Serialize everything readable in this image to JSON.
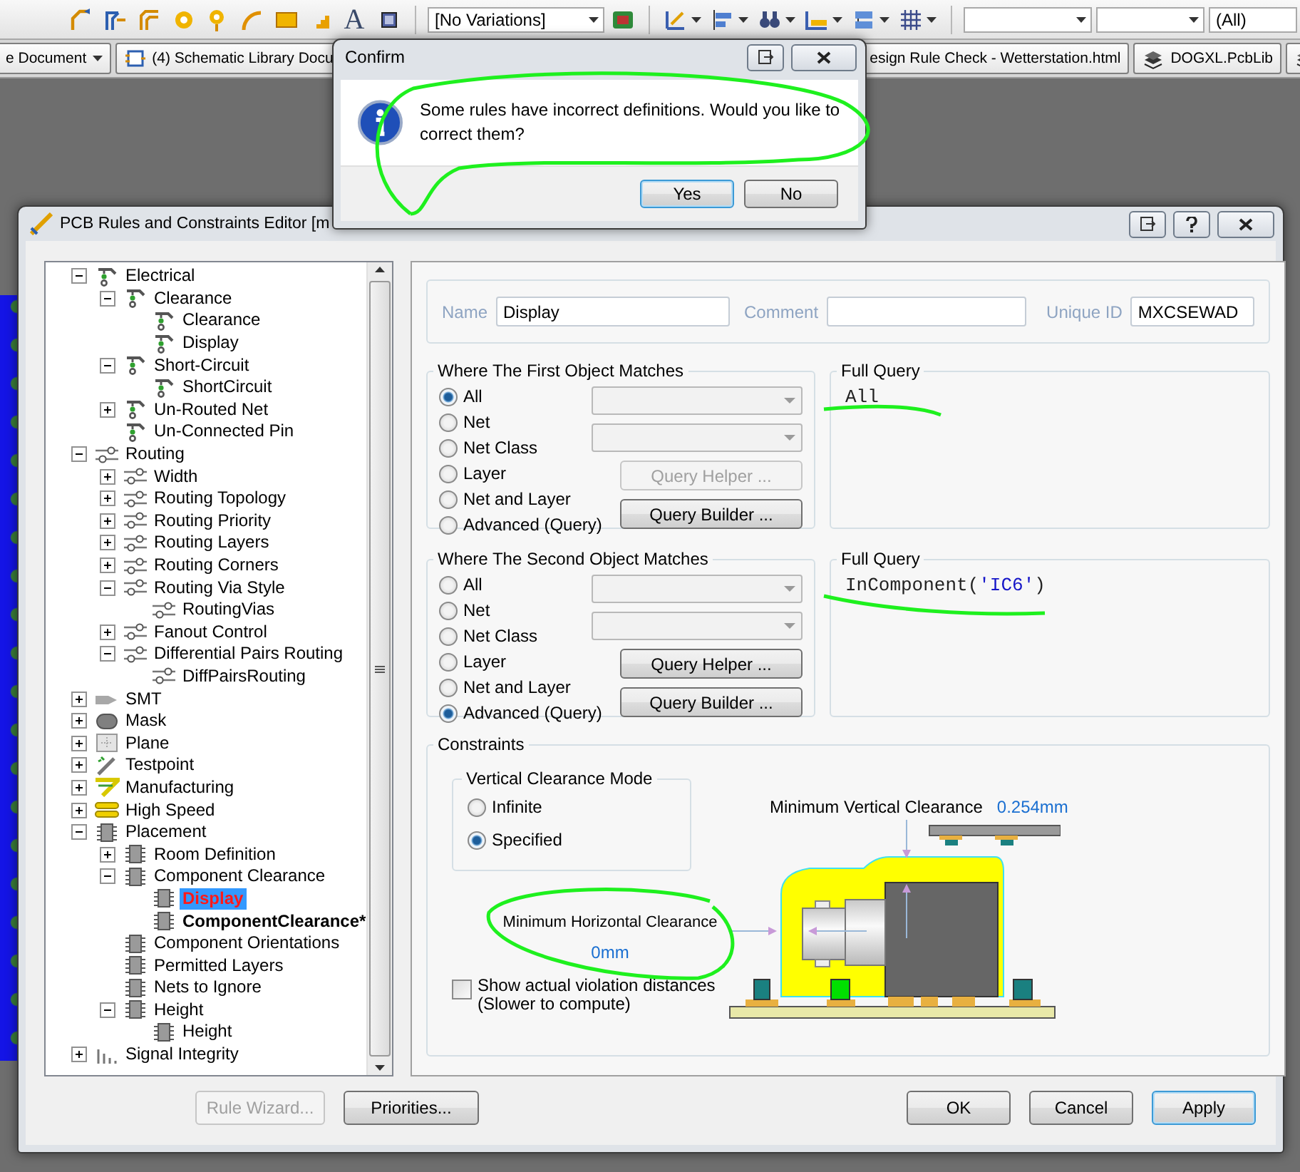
{
  "toolbar": {
    "tools": [
      {
        "kind": "route"
      },
      {
        "kind": "route-multi"
      },
      {
        "kind": "route-diff"
      },
      {
        "kind": "pad"
      },
      {
        "kind": "via"
      },
      {
        "kind": "arc"
      },
      {
        "kind": "fill"
      },
      {
        "kind": "polygon"
      },
      {
        "kind": "text",
        "glyph": "A"
      },
      {
        "kind": "component"
      }
    ],
    "variations": "[No Variations]",
    "menus": [
      {
        "kind": "board",
        "menu": false
      },
      {
        "kind": "place",
        "menu": true
      },
      {
        "kind": "align",
        "menu": true
      },
      {
        "kind": "find",
        "menu": true
      },
      {
        "kind": "ruler",
        "menu": true
      },
      {
        "kind": "layers",
        "menu": true
      },
      {
        "kind": "grid",
        "menu": true
      }
    ],
    "filter": "(All)"
  },
  "documents": [
    {
      "label": "e Document",
      "kind": "plain",
      "menu": true
    },
    {
      "label": "(4) Schematic Library Docu",
      "kind": "schlib",
      "menu": false
    },
    {
      "label": "esign Rule Check - Wetterstation.html",
      "kind": "plain",
      "menu": false
    },
    {
      "label": "DOGXL.PcbLib",
      "kind": "pcblib",
      "menu": false
    },
    {
      "kind": "pcblib",
      "menu": false
    }
  ],
  "editor": {
    "title": "PCB Rules and Constraints Editor [m",
    "tree": [
      {
        "label": "Electrical",
        "kind": "electrical",
        "expanded": true,
        "selected": false,
        "children": [
          {
            "label": "Clearance",
            "kind": "electrical",
            "expanded": true,
            "selected": false,
            "children": [
              {
                "label": "Clearance",
                "kind": "electrical",
                "selected": false
              },
              {
                "label": "Display",
                "kind": "electrical",
                "selected": false
              }
            ]
          },
          {
            "label": "Short-Circuit",
            "kind": "electrical",
            "expanded": true,
            "selected": false,
            "children": [
              {
                "label": "ShortCircuit",
                "kind": "electrical",
                "selected": false
              }
            ]
          },
          {
            "label": "Un-Routed Net",
            "kind": "electrical",
            "expanded": false,
            "selected": false
          },
          {
            "label": "Un-Connected Pin",
            "kind": "electrical",
            "selected": false
          }
        ]
      },
      {
        "label": "Routing",
        "kind": "routing",
        "expanded": true,
        "selected": false,
        "children": [
          {
            "label": "Width",
            "kind": "routing",
            "expanded": false,
            "selected": false
          },
          {
            "label": "Routing Topology",
            "kind": "routing",
            "expanded": false,
            "selected": false
          },
          {
            "label": "Routing Priority",
            "kind": "routing",
            "expanded": false,
            "selected": false
          },
          {
            "label": "Routing Layers",
            "kind": "routing",
            "expanded": false,
            "selected": false
          },
          {
            "label": "Routing Corners",
            "kind": "routing",
            "expanded": false,
            "selected": false
          },
          {
            "label": "Routing Via Style",
            "kind": "routing",
            "expanded": true,
            "selected": false,
            "children": [
              {
                "label": "RoutingVias",
                "kind": "routing",
                "selected": false
              }
            ]
          },
          {
            "label": "Fanout Control",
            "kind": "routing",
            "expanded": false,
            "selected": false
          },
          {
            "label": "Differential Pairs Routing",
            "kind": "routing",
            "expanded": true,
            "selected": false,
            "children": [
              {
                "label": "DiffPairsRouting",
                "kind": "routing",
                "selected": false
              }
            ]
          }
        ]
      },
      {
        "label": "SMT",
        "kind": "smt",
        "expanded": false,
        "selected": false
      },
      {
        "label": "Mask",
        "kind": "mask",
        "expanded": false,
        "selected": false
      },
      {
        "label": "Plane",
        "kind": "plane",
        "expanded": false,
        "selected": false
      },
      {
        "label": "Testpoint",
        "kind": "testpoint",
        "expanded": false,
        "selected": false
      },
      {
        "label": "Manufacturing",
        "kind": "manufacturing",
        "expanded": false,
        "selected": false
      },
      {
        "label": "High Speed",
        "kind": "highspeed",
        "expanded": false,
        "selected": false
      },
      {
        "label": "Placement",
        "kind": "placement",
        "expanded": true,
        "selected": false,
        "children": [
          {
            "label": "Room Definition",
            "kind": "placement",
            "expanded": false,
            "selected": false
          },
          {
            "label": "Component Clearance",
            "kind": "placement",
            "expanded": true,
            "selected": false,
            "children": [
              {
                "label": "Display",
                "kind": "placement",
                "selected": true,
                "has_errors": true
              },
              {
                "label": "ComponentClearance*",
                "kind": "placement",
                "selected": false,
                "unsaved": true
              }
            ]
          },
          {
            "label": "Component Orientations",
            "kind": "placement",
            "selected": false
          },
          {
            "label": "Permitted Layers",
            "kind": "placement",
            "selected": false
          },
          {
            "label": "Nets to Ignore",
            "kind": "placement",
            "selected": false
          },
          {
            "label": "Height",
            "kind": "placement",
            "expanded": true,
            "selected": false,
            "children": [
              {
                "label": "Height",
                "kind": "placement",
                "selected": false
              }
            ]
          }
        ]
      },
      {
        "label": "Signal Integrity",
        "kind": "signal",
        "expanded": false,
        "selected": false
      }
    ],
    "rule": {
      "name_label": "Name",
      "name": "Display",
      "comment_label": "Comment",
      "unique_id_label": "Unique ID",
      "unique_id": "MXCSEWAD"
    },
    "first_object": {
      "title": "Where The First Object Matches",
      "options": [
        {
          "label": "All",
          "selected": true
        },
        {
          "label": "Net",
          "selected": false
        },
        {
          "label": "Net Class",
          "selected": false
        },
        {
          "label": "Layer",
          "selected": false
        },
        {
          "label": "Net and Layer",
          "selected": false
        },
        {
          "label": "Advanced (Query)",
          "selected": false
        }
      ],
      "dropdowns": [
        {
          "disabled": true
        },
        {
          "disabled": true
        }
      ],
      "buttons": [
        {
          "label": "Query Helper ...",
          "disabled": true
        },
        {
          "label": "Query Builder ...",
          "disabled": false
        }
      ]
    },
    "first_query": {
      "title": "Full Query",
      "tokens": [
        {
          "text": "All",
          "kind": "code"
        }
      ]
    },
    "second_object": {
      "title": "Where The Second Object Matches",
      "options": [
        {
          "label": "All",
          "selected": false
        },
        {
          "label": "Net",
          "selected": false
        },
        {
          "label": "Net Class",
          "selected": false
        },
        {
          "label": "Layer",
          "selected": false
        },
        {
          "label": "Net and Layer",
          "selected": false
        },
        {
          "label": "Advanced (Query)",
          "selected": true
        }
      ],
      "dropdowns": [
        {
          "disabled": true
        },
        {
          "disabled": true
        }
      ],
      "buttons": [
        {
          "label": "Query Helper ...",
          "disabled": false
        },
        {
          "label": "Query Builder ...",
          "disabled": false
        }
      ]
    },
    "second_query": {
      "title": "Full Query",
      "tokens": [
        {
          "text": "InComponent(",
          "kind": "code"
        },
        {
          "text": "'IC6'",
          "kind": "string"
        },
        {
          "text": ")",
          "kind": "code"
        }
      ]
    },
    "constraints": {
      "title": "Constraints",
      "mode": {
        "title": "Vertical Clearance Mode",
        "options": [
          {
            "label": "Infinite",
            "selected": false
          },
          {
            "label": "Specified",
            "selected": true
          }
        ]
      },
      "vertical_label": "Minimum Vertical Clearance",
      "vertical_value": "0.254mm",
      "horizontal_label": "Minimum Horizontal Clearance",
      "horizontal_value": "0mm",
      "show_violations": {
        "label": "Show actual violation distances",
        "note": "(Slower to compute)",
        "checked": false
      }
    },
    "left_buttons": [
      {
        "label": "Rule Wizard...",
        "disabled": true,
        "default": false
      },
      {
        "label": "Priorities...",
        "disabled": false,
        "default": false
      }
    ],
    "right_buttons": [
      {
        "label": "OK",
        "disabled": false,
        "default": false
      },
      {
        "label": "Cancel",
        "disabled": false,
        "default": false
      },
      {
        "label": "Apply",
        "disabled": false,
        "default": true
      }
    ]
  },
  "confirm": {
    "title": "Confirm",
    "message": "Some rules have incorrect definitions. Would you like to correct them?",
    "buttons": [
      {
        "label": "Yes",
        "default": true
      },
      {
        "label": "No",
        "default": false
      }
    ]
  }
}
